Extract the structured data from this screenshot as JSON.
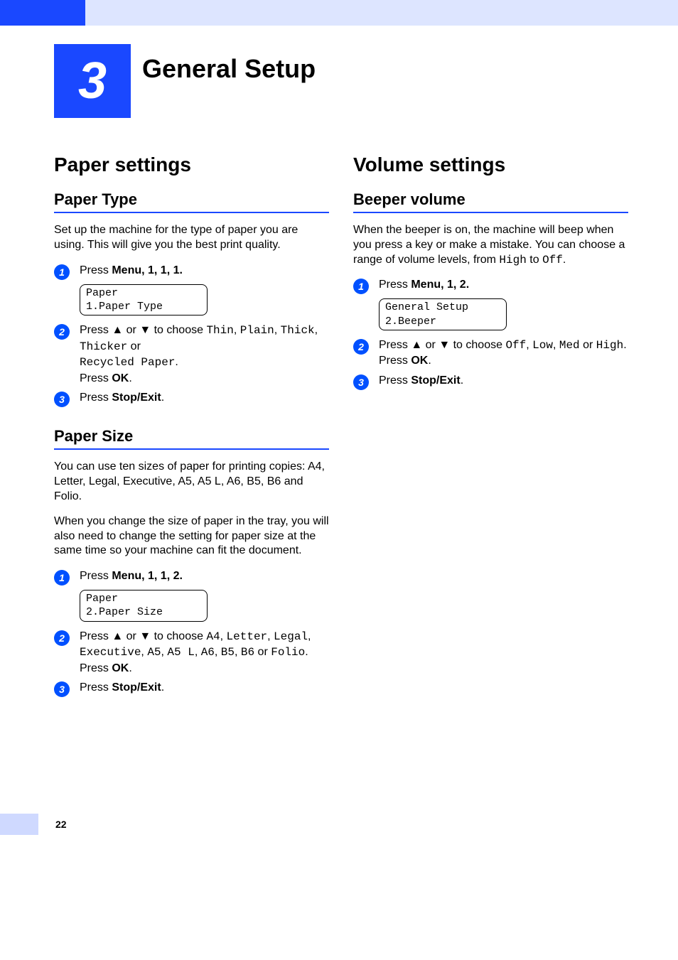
{
  "chapter": {
    "number": "3",
    "title": "General Setup"
  },
  "left": {
    "h2": "Paper settings",
    "paperType": {
      "h3": "Paper Type",
      "intro": "Set up the machine for the type of paper you are using. This will give you the best print quality.",
      "step1": {
        "press": "Press ",
        "menu": "Menu",
        "seq": ", 1, 1, 1."
      },
      "lcd": {
        "l1": "Paper",
        "l2": "1.Paper Type"
      },
      "step2": {
        "press": "Press ",
        "mid": " to choose ",
        "opts": {
          "thin": "Thin",
          "plain": "Plain",
          "thick": "Thick",
          "thicker": "Thicker",
          "recycled": "Recycled Paper"
        },
        "or": " or ",
        "comma": ", ",
        "period": ".",
        "press2": "Press ",
        "ok": "OK"
      },
      "step3": {
        "press": "Press ",
        "stop": "Stop/Exit",
        "period": "."
      }
    },
    "paperSize": {
      "h3": "Paper Size",
      "intro": "You can use ten sizes of paper for printing copies: A4, Letter, Legal, Executive, A5, A5 L, A6, B5, B6 and Folio.",
      "intro2": "When you change the size of paper in the tray, you will also need to change the setting for paper size at the same time so your machine can fit the document.",
      "step1": {
        "press": "Press ",
        "menu": "Menu",
        "seq": ", 1, 1, 2."
      },
      "lcd": {
        "l1": "Paper",
        "l2": "2.Paper Size"
      },
      "step2": {
        "press": "Press ",
        "mid": " to choose ",
        "opts": {
          "a4": "A4",
          "letter": "Letter",
          "legal": "Legal",
          "exec": "Executive",
          "a5": "A5",
          "a5l": "A5 L",
          "a6": "A6",
          "b5": "B5",
          "b6": "B6",
          "folio": "Folio"
        },
        "or": " or ",
        "comma": ", ",
        "period": ".",
        "press2": "Press ",
        "ok": "OK"
      },
      "step3": {
        "press": "Press ",
        "stop": "Stop/Exit",
        "period": "."
      }
    }
  },
  "right": {
    "h2": "Volume settings",
    "beeper": {
      "h3": "Beeper volume",
      "intro_a": "When the beeper is on, the machine will beep when you press a key or make a mistake. You can choose a range of volume levels, from ",
      "intro_hi": "High",
      "intro_to": " to ",
      "intro_off": "Off",
      "intro_end": ".",
      "step1": {
        "press": "Press ",
        "menu": "Menu",
        "seq": ", 1, 2."
      },
      "lcd": {
        "l1": "General Setup",
        "l2": "2.Beeper"
      },
      "step2": {
        "press": "Press ",
        "mid": " to choose ",
        "opts": {
          "off": "Off",
          "low": "Low",
          "med": "Med",
          "high": "High"
        },
        "or": " or ",
        "comma": ", ",
        "period": ".",
        "press2": "Press ",
        "ok": "OK"
      },
      "step3": {
        "press": "Press ",
        "stop": "Stop/Exit",
        "period": "."
      }
    }
  },
  "glyph": {
    "up": "▲",
    "down": "▼",
    "or": " or "
  },
  "page": "22"
}
